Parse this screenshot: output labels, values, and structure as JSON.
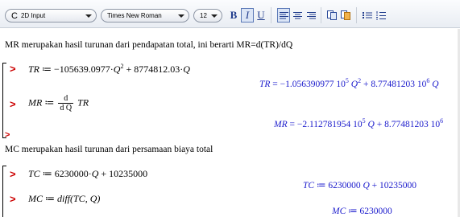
{
  "toolbar": {
    "mode_label": "2D Input",
    "font_label": "Times New Roman",
    "size_label": "12",
    "bold_label": "B",
    "italic_label": "I",
    "underline_label": "U"
  },
  "document": {
    "text1": "MR merupakan hasil turunan dari pendapatan total, ini berarti MR=d(TR)/dQ",
    "text2": "MC merupakan hasil turunan dari persamaan biaya total",
    "prompt": ">",
    "tr_input": {
      "lhs": "TR",
      "assign": "≔",
      "coef1": "−105639.0977",
      "var1": "Q",
      "exp1": "2",
      "plus": "+",
      "coef2": "8774812.03",
      "var2": "Q"
    },
    "tr_output": {
      "lhs": "TR",
      "eq": "=",
      "coef1": "−1.056390977 10",
      "exp_a": "5",
      "var1": "Q",
      "exp1": "2",
      "plus": "+",
      "coef2": "8.77481203 10",
      "exp_b": "6",
      "var2": "Q"
    },
    "mr_input": {
      "lhs": "MR",
      "assign": "≔",
      "d_num": "d",
      "d_den": "d Q",
      "rhs": "TR"
    },
    "mr_output": {
      "lhs": "MR",
      "eq": "=",
      "coef1": "−2.112781954 10",
      "exp_a": "5",
      "var1": "Q",
      "plus": "+",
      "coef2": "8.77481203 10",
      "exp_b": "6"
    },
    "tc_input": {
      "lhs": "TC",
      "assign": "≔",
      "coef1": "6230000",
      "var1": "Q",
      "plus": "+",
      "const": "10235000"
    },
    "tc_output": {
      "lhs": "TC",
      "eq": "≔",
      "coef1": "6230000",
      "var1": "Q",
      "plus": "+",
      "const": "10235000"
    },
    "mc_input": {
      "lhs": "MC",
      "assign": "≔",
      "fn": "diff",
      "args": "(TC, Q)"
    },
    "mc_output": {
      "lhs": "MC",
      "eq": "≔",
      "value": "6230000"
    }
  },
  "colors": {
    "prompt": "#cc0000",
    "output": "#1a1acc",
    "toolbar_icon": "#1f3b8c"
  }
}
